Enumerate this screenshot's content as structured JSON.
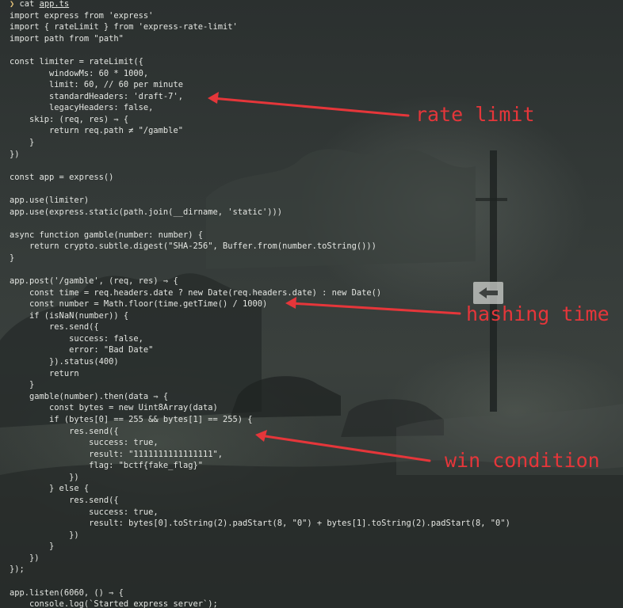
{
  "terminal": {
    "prompt_symbol": "❯",
    "command": "cat",
    "argument": "app.ts",
    "code_lines": [
      "import express from 'express'",
      "import { rateLimit } from 'express-rate-limit'",
      "import path from \"path\"",
      "",
      "const limiter = rateLimit({",
      "        windowMs: 60 * 1000,",
      "        limit: 60, // 60 per minute",
      "        standardHeaders: 'draft-7',",
      "        legacyHeaders: false,",
      "    skip: (req, res) ⇒ {",
      "        return req.path ≠ \"/gamble\"",
      "    }",
      "})",
      "",
      "const app = express()",
      "",
      "app.use(limiter)",
      "app.use(express.static(path.join(__dirname, 'static')))",
      "",
      "async function gamble(number: number) {",
      "    return crypto.subtle.digest(\"SHA-256\", Buffer.from(number.toString()))",
      "}",
      "",
      "app.post('/gamble', (req, res) ⇒ {",
      "    const time = req.headers.date ? new Date(req.headers.date) : new Date()",
      "    const number = Math.floor(time.getTime() / 1000)",
      "    if (isNaN(number)) {",
      "        res.send({",
      "            success: false,",
      "            error: \"Bad Date\"",
      "        }).status(400)",
      "        return",
      "    }",
      "    gamble(number).then(data ⇒ {",
      "        const bytes = new Uint8Array(data)",
      "        if (bytes[0] == 255 && bytes[1] == 255) {",
      "            res.send({",
      "                success: true,",
      "                result: \"1111111111111111\",",
      "                flag: \"bctf{fake_flag}\"",
      "            })",
      "        } else {",
      "            res.send({",
      "                success: true,",
      "                result: bytes[0].toString(2).padStart(8, \"0\") + bytes[1].toString(2).padStart(8, \"0\")",
      "            })",
      "        }",
      "    })",
      "});",
      "",
      "app.listen(6060, () ⇒ {",
      "    console.log(`Started express server`);"
    ]
  },
  "annotations": {
    "rate_limit": "rate limit",
    "hashing_time": "hashing time",
    "win_condition": "win condition"
  },
  "colors": {
    "annotation": "#e5363a",
    "text": "#e4e6e2",
    "prompt": "#e3c178"
  }
}
